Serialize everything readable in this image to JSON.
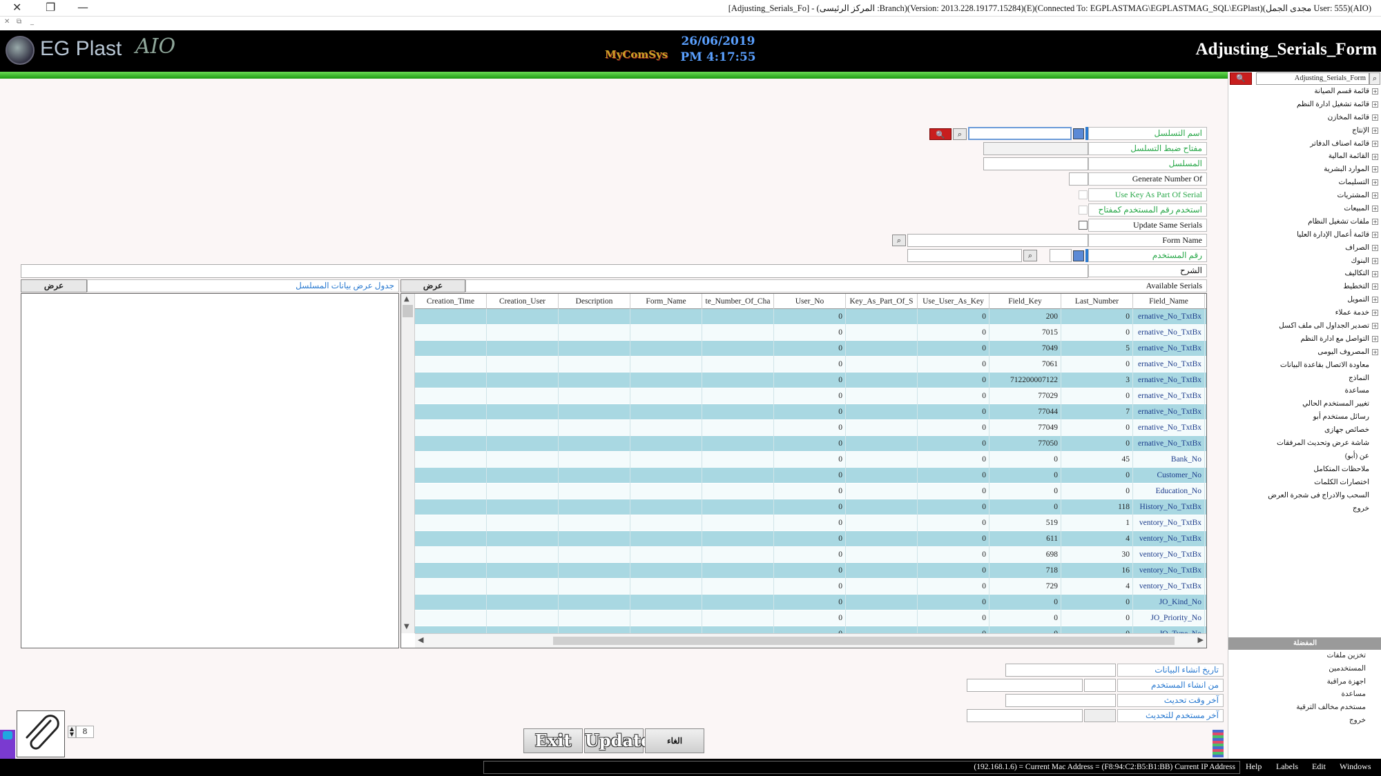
{
  "window": {
    "title": "[Adjusting_Serials_Fo] - (المركز الرئيسى :Branch)(Version: 2013.228.19177.15284)(E)(Connected To: EGPLASTMAG\\EGPLASTMAG_SQL\\EGPlast)(مجدى الجمل User: 555)(AIO)",
    "close_glyph": "✕",
    "restore_glyph": "❐",
    "minimize_glyph": "—",
    "sub_glyphs": [
      "✕",
      "⧉",
      "_"
    ]
  },
  "header": {
    "logo_text": "EG Plast",
    "logo_suffix": "AIO",
    "brand": "MyComSys",
    "date": "26/06/2019",
    "time": "PM 4:17:55",
    "form_title": "Adjusting_Serials_Form"
  },
  "sidebar": {
    "search_value": "Adjusting_Serials_Form",
    "search_glyph": "🔍",
    "tree_items": [
      {
        "label": "قائمة قسم الصيانة",
        "expand": true
      },
      {
        "label": "قائمة تشغيل ادارة النظم",
        "expand": true
      },
      {
        "label": "قائمة المخازن",
        "expand": true
      },
      {
        "label": "الإنتاج",
        "expand": true
      },
      {
        "label": "قائمة اصناف الدفاتر",
        "expand": true
      },
      {
        "label": "القائمة المالية",
        "expand": true
      },
      {
        "label": "الموارد البشرية",
        "expand": true
      },
      {
        "label": "التسليمات",
        "expand": true
      },
      {
        "label": "المشتريات",
        "expand": true
      },
      {
        "label": "المبيعات",
        "expand": true
      },
      {
        "label": "ملفات تشغيل النظام",
        "expand": true
      },
      {
        "label": "قائمة أعمال الإدارة العليا",
        "expand": true
      },
      {
        "label": "الصراف",
        "expand": true
      },
      {
        "label": "البنوك",
        "expand": true
      },
      {
        "label": "التكاليف",
        "expand": true
      },
      {
        "label": "التخطيط",
        "expand": true
      },
      {
        "label": "التمويل",
        "expand": true
      },
      {
        "label": "خدمة عملاء",
        "expand": true
      },
      {
        "label": "تصدير الجداول الى ملف اكسل",
        "expand": true
      },
      {
        "label": "التواصل مع ادارة النظم",
        "expand": true
      },
      {
        "label": "المصروف اليومى",
        "expand": true
      },
      {
        "label": "معاودة الاتصال بقاعدة البيانات",
        "expand": false
      },
      {
        "label": "النماذج",
        "expand": false
      },
      {
        "label": "مساعدة",
        "expand": false
      },
      {
        "label": "تغيير المستخدم الحالي",
        "expand": false
      },
      {
        "label": "رسائل مستخدم أبو",
        "expand": false
      },
      {
        "label": "خصائص جهازى",
        "expand": false
      },
      {
        "label": "شاشة عرض وتحديث المرفقات",
        "expand": false
      },
      {
        "label": "عن (أبو)",
        "expand": false
      },
      {
        "label": "ملاحظات المتكامل",
        "expand": false
      },
      {
        "label": "اختصارات الكلمات",
        "expand": false
      },
      {
        "label": "السحب والادراج فى شجرة العرض",
        "expand": false
      },
      {
        "label": "خروج",
        "expand": false
      }
    ],
    "favorites_header": "المفضلة",
    "favorites": [
      "تخزين ملفات",
      "المستخدمين",
      "اجهزة مراقبة",
      "مساعدة",
      "مستخدم مخالف الترقية",
      "خروج"
    ]
  },
  "form": {
    "serial_name_label": "اسم التسلسل",
    "serial_key_label": "مفتاح ضبط التسلسل",
    "serial_label": "المسلسل",
    "generate_number_label": "Generate Number Of",
    "use_key_label": "Use Key As Part Of Serial",
    "use_user_label": "استخدم رقم المستخدم كمفتاح",
    "update_same_label": "Update Same Serials",
    "form_name_label": "Form Name",
    "user_no_label": "رقم المستخدم",
    "description_label": "الشرح",
    "search_glyph": "🔍",
    "mag_glyph": "⌕"
  },
  "panels": {
    "left_view_button": "عرض",
    "left_title": "جدول عرض بيانات المسلسل",
    "right_view_button": "عرض",
    "right_title": "Available Serials"
  },
  "grid": {
    "columns": [
      "Creation_Time",
      "Creation_User",
      "Description",
      "Form_Name",
      "te_Number_Of_Cha",
      "User_No",
      "Key_As_Part_Of_S",
      "Use_User_As_Key",
      "Field_Key",
      "Last_Number",
      "Field_Name"
    ],
    "rows": [
      {
        "user_no": "0",
        "key_part": "",
        "use_user": "0",
        "field_key": "200",
        "last_number": "0",
        "field_name": "ernative_No_TxtBx"
      },
      {
        "user_no": "0",
        "key_part": "",
        "use_user": "0",
        "field_key": "7015",
        "last_number": "0",
        "field_name": "ernative_No_TxtBx"
      },
      {
        "user_no": "0",
        "key_part": "",
        "use_user": "0",
        "field_key": "7049",
        "last_number": "5",
        "field_name": "ernative_No_TxtBx"
      },
      {
        "user_no": "0",
        "key_part": "",
        "use_user": "0",
        "field_key": "7061",
        "last_number": "0",
        "field_name": "ernative_No_TxtBx"
      },
      {
        "user_no": "0",
        "key_part": "",
        "use_user": "0",
        "field_key": "712200007122",
        "last_number": "3",
        "field_name": "ernative_No_TxtBx"
      },
      {
        "user_no": "0",
        "key_part": "",
        "use_user": "0",
        "field_key": "77029",
        "last_number": "0",
        "field_name": "ernative_No_TxtBx"
      },
      {
        "user_no": "0",
        "key_part": "",
        "use_user": "0",
        "field_key": "77044",
        "last_number": "7",
        "field_name": "ernative_No_TxtBx"
      },
      {
        "user_no": "0",
        "key_part": "",
        "use_user": "0",
        "field_key": "77049",
        "last_number": "0",
        "field_name": "ernative_No_TxtBx"
      },
      {
        "user_no": "0",
        "key_part": "",
        "use_user": "0",
        "field_key": "77050",
        "last_number": "0",
        "field_name": "ernative_No_TxtBx"
      },
      {
        "user_no": "0",
        "key_part": "",
        "use_user": "0",
        "field_key": "0",
        "last_number": "45",
        "field_name": "Bank_No"
      },
      {
        "user_no": "0",
        "key_part": "",
        "use_user": "0",
        "field_key": "0",
        "last_number": "0",
        "field_name": "Customer_No"
      },
      {
        "user_no": "0",
        "key_part": "",
        "use_user": "0",
        "field_key": "0",
        "last_number": "0",
        "field_name": "Education_No"
      },
      {
        "user_no": "0",
        "key_part": "",
        "use_user": "0",
        "field_key": "0",
        "last_number": "118",
        "field_name": "History_No_TxtBx"
      },
      {
        "user_no": "0",
        "key_part": "",
        "use_user": "0",
        "field_key": "519",
        "last_number": "1",
        "field_name": "ventory_No_TxtBx"
      },
      {
        "user_no": "0",
        "key_part": "",
        "use_user": "0",
        "field_key": "611",
        "last_number": "4",
        "field_name": "ventory_No_TxtBx"
      },
      {
        "user_no": "0",
        "key_part": "",
        "use_user": "0",
        "field_key": "698",
        "last_number": "30",
        "field_name": "ventory_No_TxtBx"
      },
      {
        "user_no": "0",
        "key_part": "",
        "use_user": "0",
        "field_key": "718",
        "last_number": "16",
        "field_name": "ventory_No_TxtBx"
      },
      {
        "user_no": "0",
        "key_part": "",
        "use_user": "0",
        "field_key": "729",
        "last_number": "4",
        "field_name": "ventory_No_TxtBx"
      },
      {
        "user_no": "0",
        "key_part": "",
        "use_user": "0",
        "field_key": "0",
        "last_number": "0",
        "field_name": "JO_Kind_No"
      },
      {
        "user_no": "0",
        "key_part": "",
        "use_user": "0",
        "field_key": "0",
        "last_number": "0",
        "field_name": "JO_Priority_No"
      },
      {
        "user_no": "0",
        "key_part": "",
        "use_user": "0",
        "field_key": "0",
        "last_number": "0",
        "field_name": "JO_Type_No"
      }
    ]
  },
  "audit": {
    "created_date_label": "تاريخ انشاء البيانات",
    "created_by_label": "من انشاء المستخدم",
    "last_update_label": "آخر وقت تحديث",
    "last_user_label": "آخر مستخدم للتحديث"
  },
  "bottom": {
    "exit_label": "Exit",
    "update_label": "Update",
    "cancel_label": "الغاء",
    "attach_count": "8"
  },
  "statusbar": {
    "text": "(192.168.1.6) = Current Mac Address = (F8:94:C2:B5:B1:BB) Current IP Address",
    "menus": [
      "Help",
      "Labels",
      "Edit",
      "Windows"
    ]
  },
  "colors": {
    "row_odd": "#a9d8e2",
    "row_even": "#f4fbfc",
    "header_bg": "#000000",
    "accent_green": "#2aa84a",
    "accent_red": "#c81e1e",
    "date_blue": "#5aa0ff"
  }
}
